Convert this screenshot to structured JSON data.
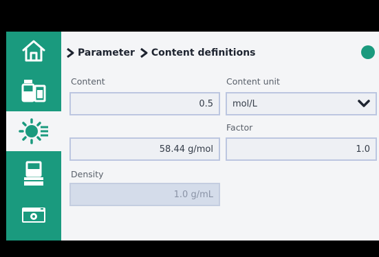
{
  "breadcrumb": {
    "items": [
      "Parameter",
      "Content definitions"
    ]
  },
  "colors": {
    "accent": "#1a9a7e",
    "field_border": "#bcc6e0",
    "disabled_fill": "#d4dcea"
  },
  "sidebar": {
    "items": [
      {
        "icon": "home-icon",
        "active": false
      },
      {
        "icon": "chemicals-icon",
        "active": false
      },
      {
        "icon": "settings-sun-icon",
        "active": true
      },
      {
        "icon": "beaker-stand-icon",
        "active": false
      },
      {
        "icon": "camera-icon",
        "active": false
      }
    ]
  },
  "form": {
    "content": {
      "label": "Content",
      "value": "0.5"
    },
    "content_unit": {
      "label": "Content unit",
      "value": "mol/L"
    },
    "molar_mass": {
      "value": "58.44 g/mol"
    },
    "factor": {
      "label": "Factor",
      "value": "1.0"
    },
    "density": {
      "label": "Density",
      "value": "1.0 g/mL"
    }
  }
}
